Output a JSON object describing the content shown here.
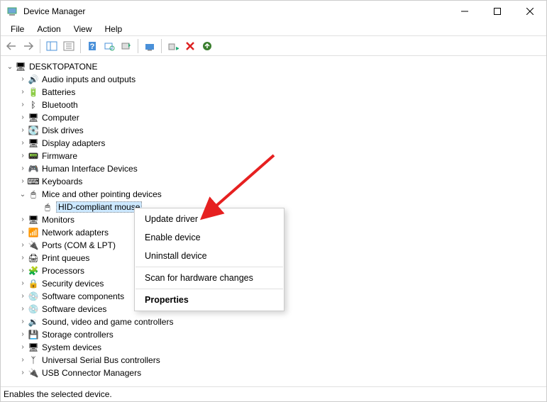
{
  "window": {
    "title": "Device Manager"
  },
  "menu": {
    "file": "File",
    "action": "Action",
    "view": "View",
    "help": "Help"
  },
  "tree": {
    "root": "DESKTOPATONE",
    "nodes": [
      {
        "label": "Audio inputs and outputs",
        "expanded": false
      },
      {
        "label": "Batteries",
        "expanded": false
      },
      {
        "label": "Bluetooth",
        "expanded": false
      },
      {
        "label": "Computer",
        "expanded": false
      },
      {
        "label": "Disk drives",
        "expanded": false
      },
      {
        "label": "Display adapters",
        "expanded": false
      },
      {
        "label": "Firmware",
        "expanded": false
      },
      {
        "label": "Human Interface Devices",
        "expanded": false
      },
      {
        "label": "Keyboards",
        "expanded": false
      },
      {
        "label": "Mice and other pointing devices",
        "expanded": true,
        "children": [
          {
            "label": "HID-compliant mouse",
            "selected": true
          }
        ]
      },
      {
        "label": "Monitors",
        "expanded": false
      },
      {
        "label": "Network adapters",
        "expanded": false
      },
      {
        "label": "Ports (COM & LPT)",
        "expanded": false
      },
      {
        "label": "Print queues",
        "expanded": false
      },
      {
        "label": "Processors",
        "expanded": false
      },
      {
        "label": "Security devices",
        "expanded": false
      },
      {
        "label": "Software components",
        "expanded": false
      },
      {
        "label": "Software devices",
        "expanded": false
      },
      {
        "label": "Sound, video and game controllers",
        "expanded": false
      },
      {
        "label": "Storage controllers",
        "expanded": false
      },
      {
        "label": "System devices",
        "expanded": false
      },
      {
        "label": "Universal Serial Bus controllers",
        "expanded": false
      },
      {
        "label": "USB Connector Managers",
        "expanded": false
      }
    ]
  },
  "context_menu": {
    "items": [
      {
        "label": "Update driver"
      },
      {
        "label": "Enable device"
      },
      {
        "label": "Uninstall device"
      },
      {
        "sep": true
      },
      {
        "label": "Scan for hardware changes"
      },
      {
        "sep": true
      },
      {
        "label": "Properties",
        "bold": true
      }
    ]
  },
  "status": {
    "text": "Enables the selected device."
  },
  "icons": {
    "audio": "🔊",
    "battery": "🔋",
    "bluetooth": "ᛒ",
    "computer": "🖥",
    "disk": "💽",
    "display": "🖥",
    "firmware": "📟",
    "hid": "🎮",
    "keyboard": "⌨",
    "mouse": "🖱",
    "monitor": "🖥",
    "network": "📶",
    "port": "🔌",
    "printer": "🖨",
    "cpu": "🧩",
    "security": "🔒",
    "software": "💿",
    "sound": "🔉",
    "storage": "💾",
    "system": "🖥",
    "usb": "ᛉ",
    "usbconn": "🔌"
  }
}
